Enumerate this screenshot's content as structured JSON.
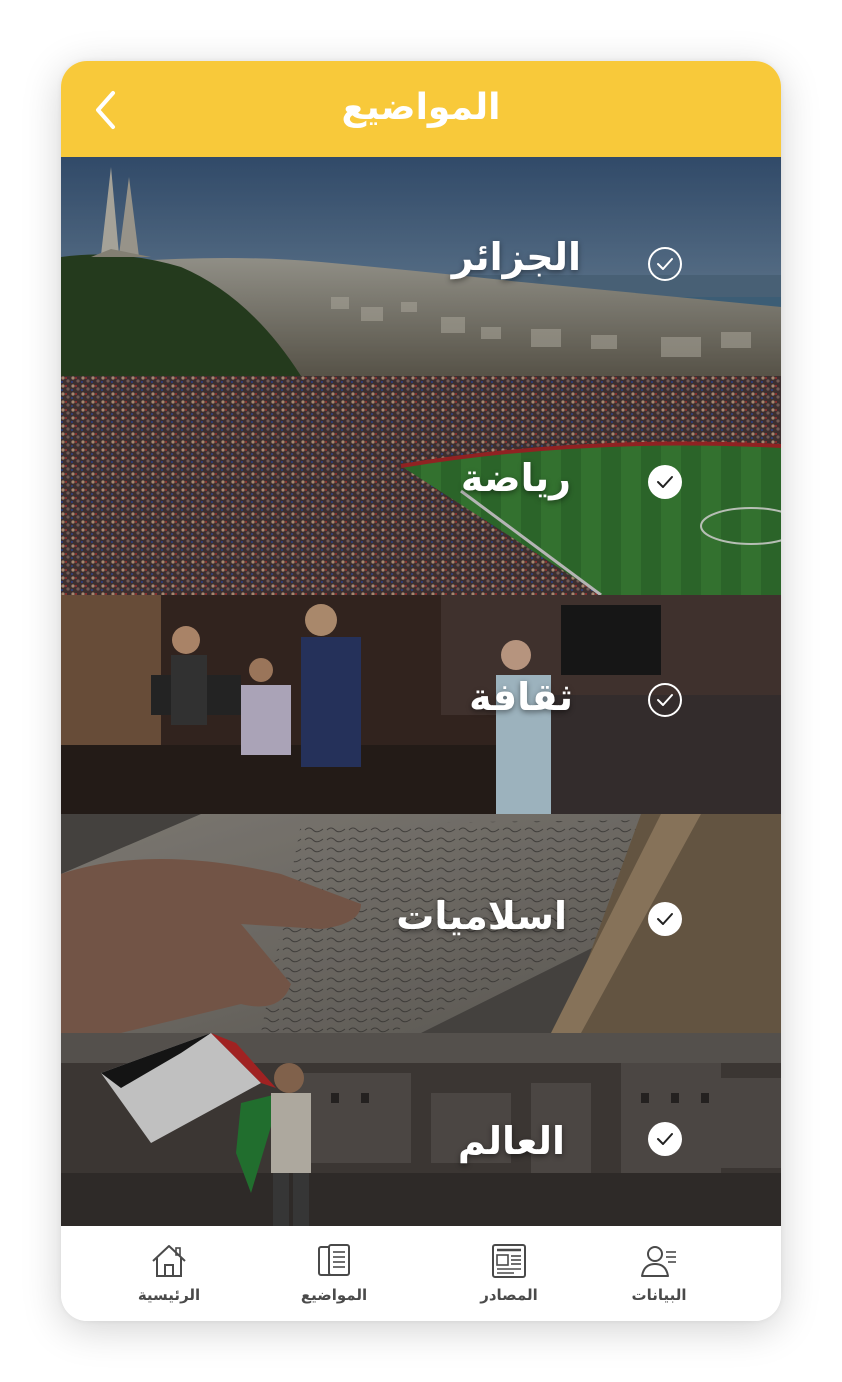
{
  "header": {
    "title": "المواضيع",
    "back_icon": "chevron-left-icon",
    "background_color": "#f8c93a"
  },
  "topics": [
    {
      "label": "الجزائر",
      "selected": true,
      "check_style": "outline",
      "scene": "city skyline by the sea with monument"
    },
    {
      "label": "رياضة",
      "selected": true,
      "check_style": "filled",
      "scene": "football stadium crowd"
    },
    {
      "label": "ثقافة",
      "selected": true,
      "check_style": "outline",
      "scene": "theater stage performance"
    },
    {
      "label": "اسلاميات",
      "selected": true,
      "check_style": "filled",
      "scene": "hand on open quran pages"
    },
    {
      "label": "العالم",
      "selected": true,
      "check_style": "filled",
      "scene": "child with flag over ruined city"
    }
  ],
  "tabbar": {
    "items": [
      {
        "label": "الرئيسية",
        "icon": "home-icon"
      },
      {
        "label": "المواضيع",
        "icon": "topics-icon"
      },
      {
        "label": "المصادر",
        "icon": "newspaper-icon"
      },
      {
        "label": "البيانات",
        "icon": "profile-icon"
      }
    ]
  }
}
